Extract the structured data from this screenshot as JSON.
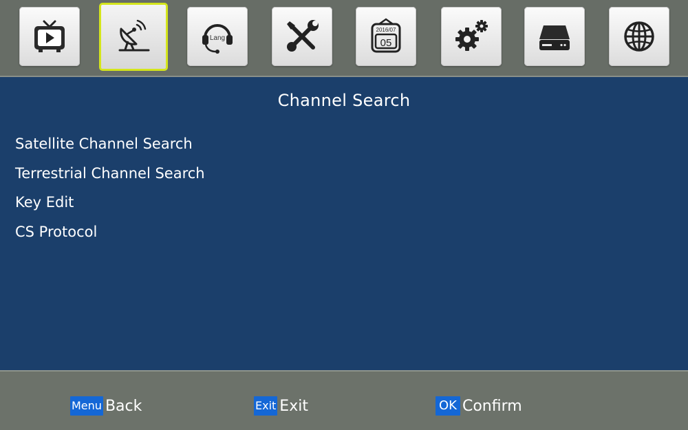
{
  "toolbar": {
    "tiles": [
      {
        "icon": "tv-icon",
        "label": "TV"
      },
      {
        "icon": "satellite-dish-icon",
        "label": "Channel Search",
        "selected": true
      },
      {
        "icon": "language-headset-icon",
        "label": "Lang"
      },
      {
        "icon": "tools-icon",
        "label": "Tools"
      },
      {
        "icon": "calendar-icon",
        "label": "Calendar",
        "calendar_month": "2016/07",
        "calendar_day": "05"
      },
      {
        "icon": "gears-icon",
        "label": "Settings"
      },
      {
        "icon": "hard-drive-icon",
        "label": "Storage"
      },
      {
        "icon": "globe-icon",
        "label": "Network"
      }
    ],
    "lang_text": "Lang",
    "calendar_month": "2016/07",
    "calendar_day": "05",
    "selected_color": "#d4e51c"
  },
  "panel": {
    "title": "Channel Search",
    "background_color": "#1b3f6b",
    "items": [
      {
        "label": "Satellite Channel Search"
      },
      {
        "label": "Terrestrial Channel Search"
      },
      {
        "label": "Key Edit"
      },
      {
        "label": "CS Protocol"
      }
    ]
  },
  "footer": {
    "key_color": "#1467d6",
    "hints": [
      {
        "key": "Menu",
        "action": "Back"
      },
      {
        "key": "Exit",
        "action": "Exit"
      },
      {
        "key": "OK",
        "action": "Confirm"
      }
    ]
  }
}
